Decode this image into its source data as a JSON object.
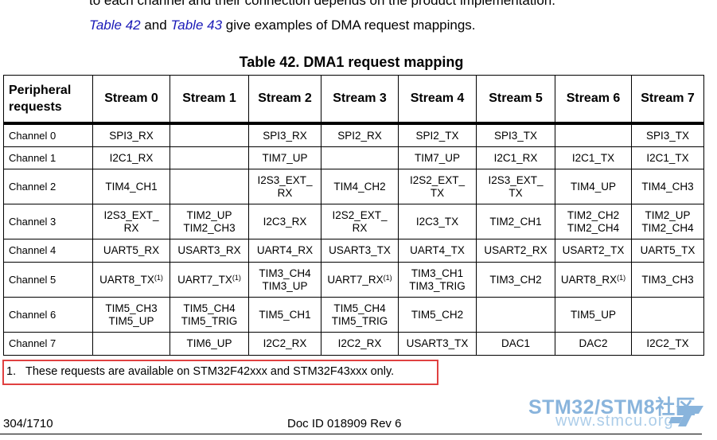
{
  "cutoff_text": "to each channel and their connection depends on the product implementation.",
  "intro": {
    "link1": "Table 42",
    "word_and": "and",
    "link2": "Table 43",
    "rest": "give examples of DMA request mappings."
  },
  "table": {
    "title": "Table 42. DMA1 request mapping",
    "corner_line1": "Peripheral",
    "corner_line2": "requests",
    "streams": [
      "Stream 0",
      "Stream 1",
      "Stream 2",
      "Stream 3",
      "Stream 4",
      "Stream 5",
      "Stream 6",
      "Stream 7"
    ],
    "rows": [
      {
        "channel": "Channel 0",
        "cells": [
          "SPI3_RX",
          "",
          "SPI3_RX",
          "SPI2_RX",
          "SPI2_TX",
          "SPI3_TX",
          "",
          "SPI3_TX"
        ]
      },
      {
        "channel": "Channel 1",
        "cells": [
          "I2C1_RX",
          "",
          "TIM7_UP",
          "",
          "TIM7_UP",
          "I2C1_RX",
          "I2C1_TX",
          "I2C1_TX"
        ]
      },
      {
        "channel": "Channel 2",
        "cells": [
          "TIM4_CH1",
          "",
          "I2S3_EXT_",
          "TIM4_CH2",
          "I2S2_EXT_",
          "I2S3_EXT_",
          "TIM4_UP",
          "TIM4_CH3"
        ],
        "cells2": [
          "",
          "",
          "RX",
          "",
          "TX",
          "TX",
          "",
          ""
        ]
      },
      {
        "channel": "Channel 3",
        "cells": [
          "I2S3_EXT_",
          "TIM2_UP",
          "I2C3_RX",
          "I2S2_EXT_",
          "I2C3_TX",
          "TIM2_CH1",
          "TIM2_CH2",
          "TIM2_UP"
        ],
        "cells2": [
          "RX",
          "TIM2_CH3",
          "",
          "RX",
          "",
          "",
          "TIM2_CH4",
          "TIM2_CH4"
        ]
      },
      {
        "channel": "Channel 4",
        "cells": [
          "UART5_RX",
          "USART3_RX",
          "UART4_RX",
          "USART3_TX",
          "UART4_TX",
          "USART2_RX",
          "USART2_TX",
          "UART5_TX"
        ]
      },
      {
        "channel": "Channel 5",
        "cells": [
          "UART8_TX",
          "UART7_TX",
          "TIM3_CH4",
          "UART7_RX",
          "TIM3_CH1",
          "TIM3_CH2",
          "UART8_RX",
          "TIM3_CH3"
        ],
        "cells2": [
          "",
          "",
          "TIM3_UP",
          "",
          "TIM3_TRIG",
          "",
          "",
          ""
        ],
        "sup": [
          "(1)",
          "(1)",
          "",
          "(1)",
          "",
          "",
          "(1)",
          ""
        ]
      },
      {
        "channel": "Channel 6",
        "cells": [
          "TIM5_CH3",
          "TIM5_CH4",
          "TIM5_CH1",
          "TIM5_CH4",
          "TIM5_CH2",
          "",
          "TIM5_UP",
          ""
        ],
        "cells2": [
          "TIM5_UP",
          "TIM5_TRIG",
          "",
          "TIM5_TRIG",
          "",
          "",
          "",
          ""
        ]
      },
      {
        "channel": "Channel 7",
        "cells": [
          "",
          "TIM6_UP",
          "I2C2_RX",
          "I2C2_RX",
          "USART3_TX",
          "DAC1",
          "DAC2",
          "I2C2_TX"
        ]
      }
    ]
  },
  "footnote": {
    "number": "1.",
    "text": "These requests are available on STM32F42xxx and STM32F43xxx only."
  },
  "footer": {
    "page": "304/1710",
    "doc_id": "Doc ID 018909 Rev 6"
  },
  "watermark": {
    "line1": "STM32/STM8社区",
    "line2": "www.stmcu.org"
  },
  "colors": {
    "link": "#1a1ab8",
    "highlight_box": "#e04040",
    "watermark": "#2a78c0"
  }
}
